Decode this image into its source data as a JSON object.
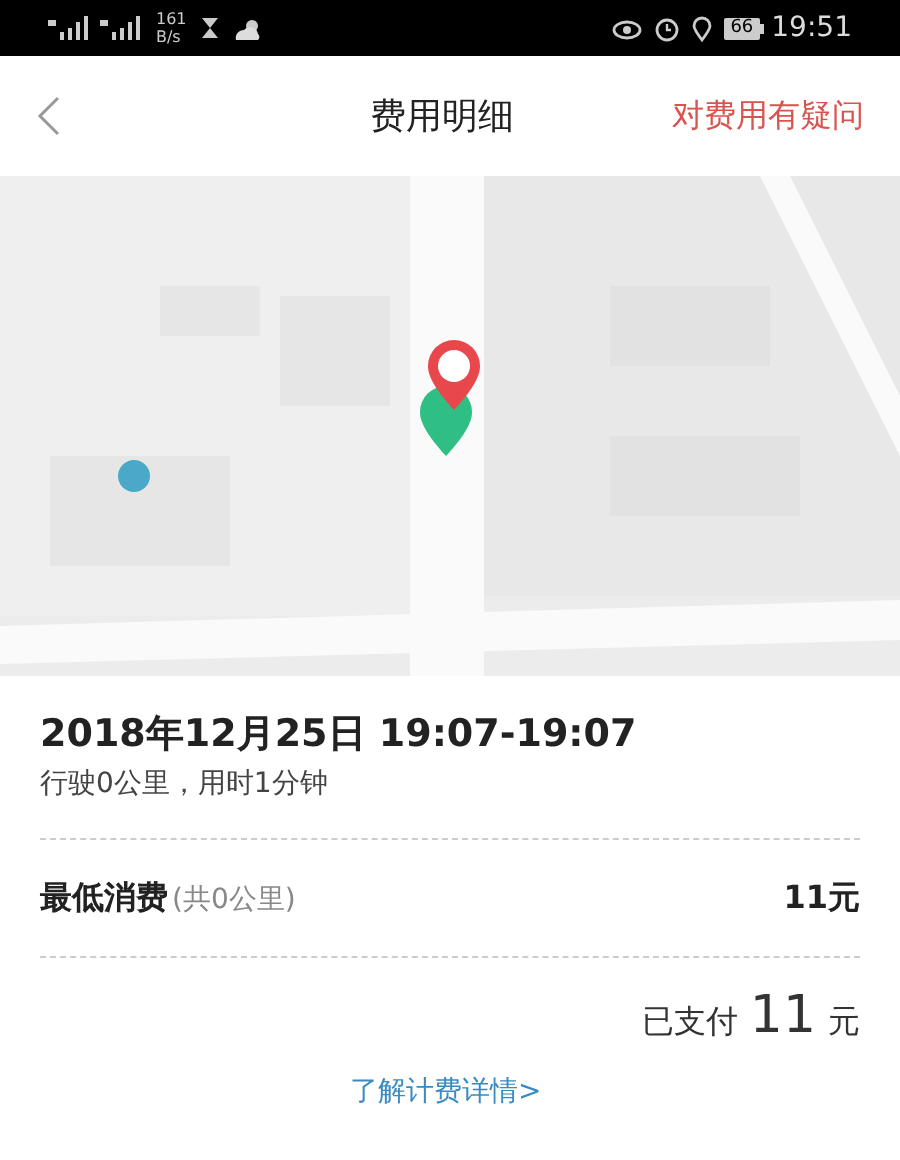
{
  "status_bar": {
    "speed": [
      "161",
      "B/s"
    ],
    "battery": "66",
    "time": "19:51"
  },
  "header": {
    "title": "费用明细",
    "action": "对费用有疑问"
  },
  "trip": {
    "time_range": "2018年12月25日 19:07-19:07",
    "summary": "行驶0公里，用时1分钟"
  },
  "charges": [
    {
      "label": "最低消费",
      "note": "(共0公里)",
      "amount": "11元"
    }
  ],
  "payment": {
    "label": "已支付",
    "amount": "11",
    "unit": "元"
  },
  "details_link": "了解计费详情>"
}
